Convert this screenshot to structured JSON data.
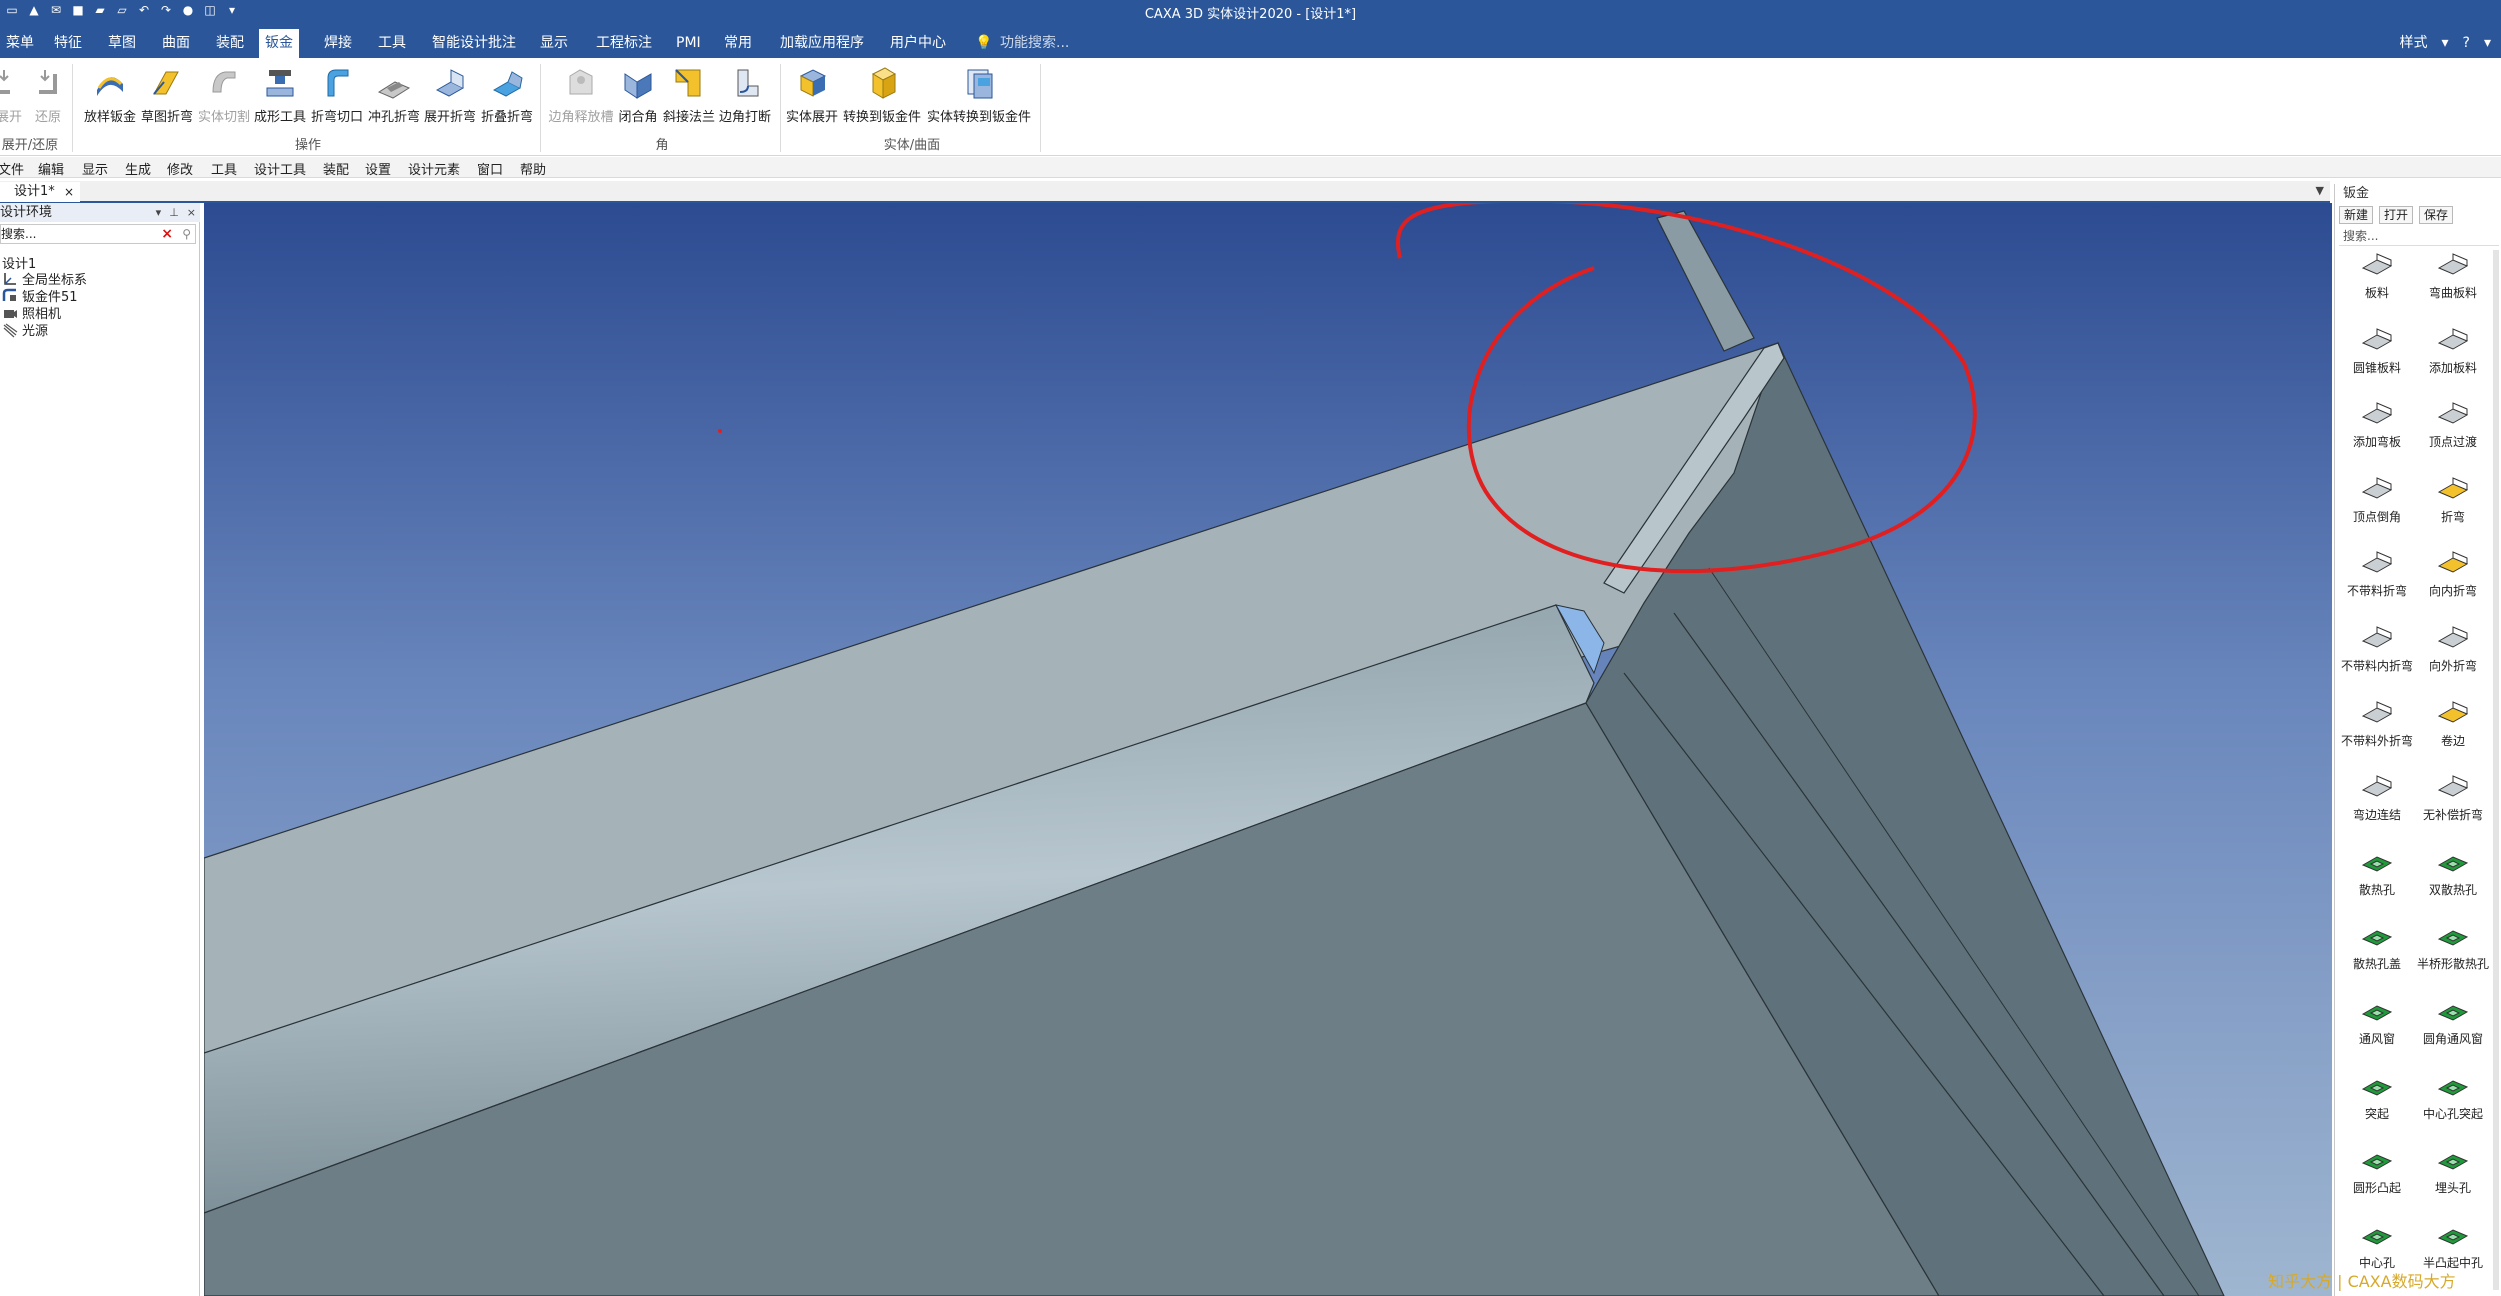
{
  "window": {
    "title": "CAXA 3D 实体设计2020 - [设计1*]"
  },
  "quick_access": [
    "new-icon",
    "open-icon",
    "mail-icon",
    "save-icon",
    "folder-icon",
    "folder2-icon",
    "undo-icon",
    "redo-icon",
    "record-icon",
    "view-icon",
    "dropdown-icon"
  ],
  "tabs": [
    "菜单",
    "特征",
    "草图",
    "曲面",
    "装配",
    "钣金",
    "焊接",
    "工具",
    "智能设计批注",
    "显示",
    "工程标注",
    "PMI",
    "常用",
    "加载应用程序",
    "用户中心"
  ],
  "active_tab": "钣金",
  "search_tip": "功能搜索...",
  "style_label": "样式",
  "ribbon": {
    "groups": [
      "展开/还原",
      "操作",
      "角",
      "实体/曲面"
    ],
    "buttons": [
      "展开",
      "还原",
      "放样钣金",
      "草图折弯",
      "实体切割",
      "成形工具",
      "折弯切口",
      "冲孔折弯",
      "展开折弯",
      "折叠折弯",
      "边角释放槽",
      "闭合角",
      "斜接法兰",
      "边角打断",
      "实体展开",
      "转换到钣金件",
      "实体转换到钣金件"
    ]
  },
  "menubar": [
    "文件",
    "编辑",
    "显示",
    "生成",
    "修改",
    "工具",
    "设计工具",
    "装配",
    "设置",
    "设计元素",
    "窗口",
    "帮助"
  ],
  "doc_tab": "设计1*",
  "left_panel": {
    "title": "设计环境",
    "search_placeholder": "搜索...",
    "tree": [
      "设计1",
      "全局坐标系",
      "钣金件51",
      "照相机",
      "光源"
    ]
  },
  "right_panel": {
    "title": "钣金",
    "buttons": [
      "新建",
      "打开",
      "保存"
    ],
    "search_placeholder": "搜索...",
    "items": [
      [
        "板料",
        "弯曲板料"
      ],
      [
        "圆锥板料",
        "添加板料"
      ],
      [
        "添加弯板",
        "顶点过渡"
      ],
      [
        "顶点倒角",
        "折弯"
      ],
      [
        "不带料折弯",
        "向内折弯"
      ],
      [
        "不带料内折弯",
        "向外折弯"
      ],
      [
        "不带料外折弯",
        "卷边"
      ],
      [
        "弯边连结",
        "无补偿折弯"
      ],
      [
        "散热孔",
        "双散热孔"
      ],
      [
        "散热孔盖",
        "半桥形散热孔"
      ],
      [
        "通风窗",
        "圆角通风窗"
      ],
      [
        "突起",
        "中心孔突起"
      ],
      [
        "圆形凸起",
        "埋头孔"
      ],
      [
        "中心孔",
        "半凸起中孔"
      ]
    ]
  },
  "watermark": "知乎大方  |  CAXA数码大方",
  "colors": {
    "title_bar": "#2b579a",
    "annotation_circle": "#e02020",
    "viewport_bg_top": "#2c4b91",
    "viewport_bg_bottom": "#9fb6d0"
  }
}
